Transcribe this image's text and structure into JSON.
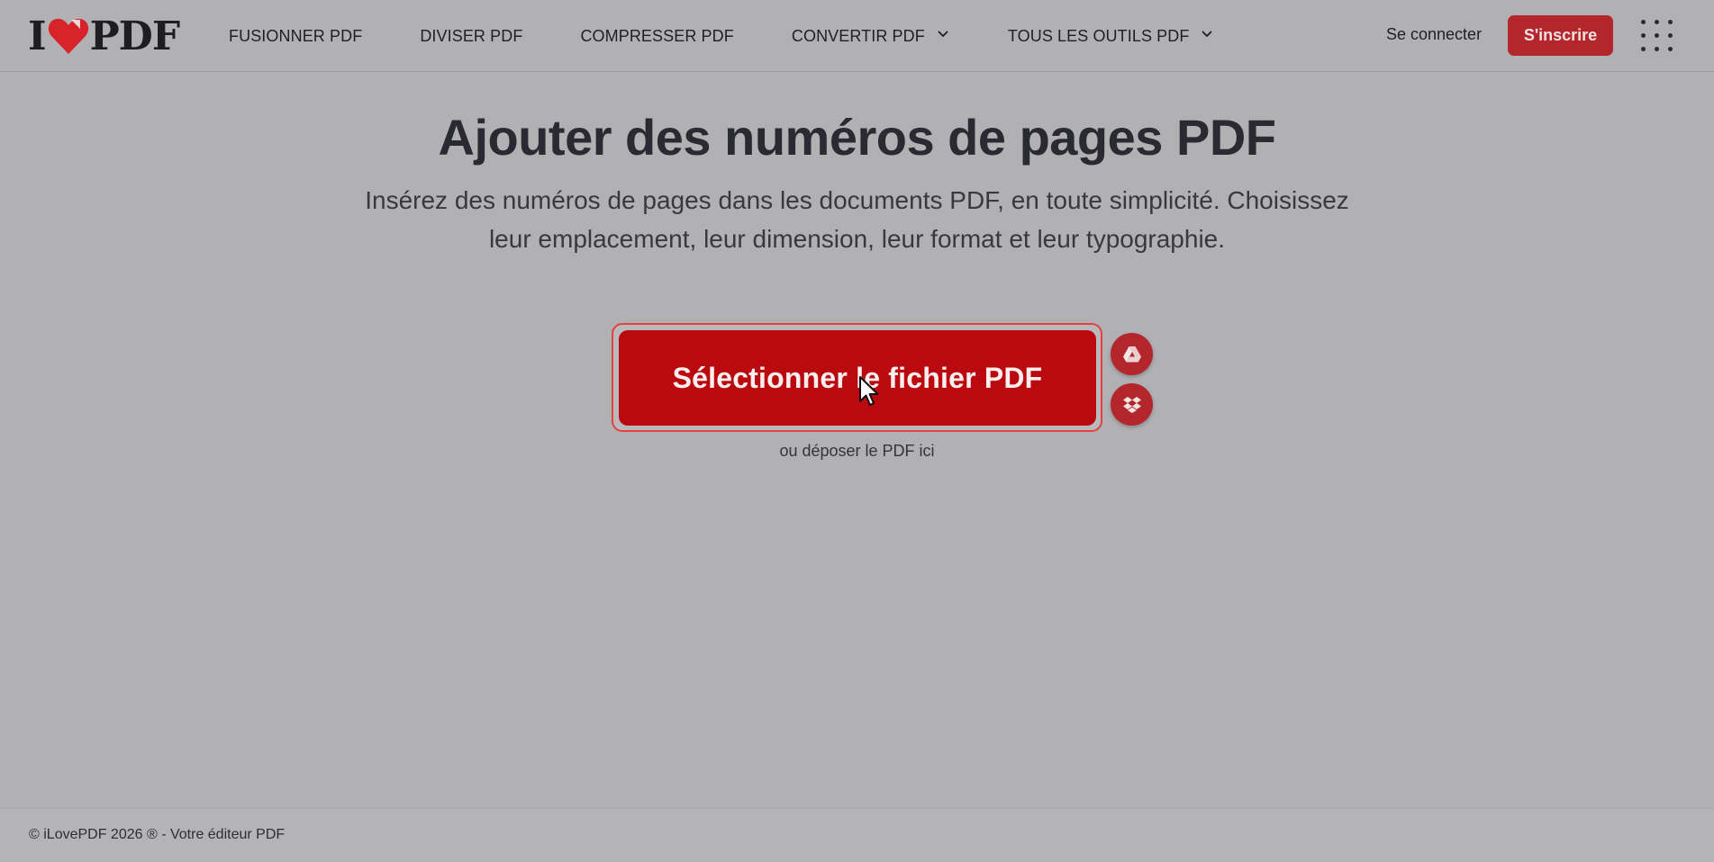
{
  "brand": {
    "logo_left": "I",
    "logo_right": "PDF",
    "heart_color": "#d8232a"
  },
  "nav": {
    "merge": "FUSIONNER PDF",
    "split": "DIVISER PDF",
    "compress": "COMPRESSER PDF",
    "convert": "CONVERTIR PDF",
    "all_tools": "TOUS LES OUTILS PDF"
  },
  "account": {
    "login": "Se connecter",
    "signup": "S'inscrire"
  },
  "main": {
    "title": "Ajouter des numéros de pages PDF",
    "subtitle": "Insérez des numéros de pages dans les documents PDF, en toute simplicité. Choisissez leur emplacement, leur dimension, leur format et leur typographie.",
    "select_button": "Sélectionner le fichier PDF",
    "drop_hint": "ou déposer le PDF ici"
  },
  "icons": {
    "google_drive": "google-drive-icon",
    "dropbox": "dropbox-icon",
    "apps": "apps-grid-icon",
    "chevron": "chevron-down-icon"
  },
  "footer": {
    "copyright": "© iLovePDF 2026 ® - Votre éditeur PDF"
  },
  "colors": {
    "accent": "#bb0a0f",
    "accent_outline": "#e6403f",
    "background": "#b1b1b3"
  }
}
